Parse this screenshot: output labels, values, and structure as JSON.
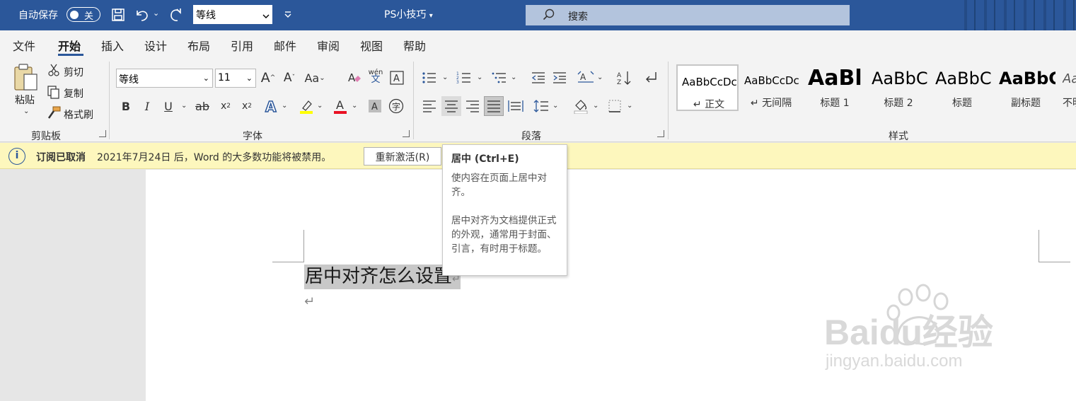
{
  "titlebar": {
    "autosave_label": "自动保存",
    "autosave_state": "关",
    "font_name": "等线",
    "doc_title": "PS小技巧",
    "search_placeholder": "搜索"
  },
  "tabs": [
    {
      "label": "文件"
    },
    {
      "label": "开始"
    },
    {
      "label": "插入"
    },
    {
      "label": "设计"
    },
    {
      "label": "布局"
    },
    {
      "label": "引用"
    },
    {
      "label": "邮件"
    },
    {
      "label": "审阅"
    },
    {
      "label": "视图"
    },
    {
      "label": "帮助"
    }
  ],
  "ribbon": {
    "clipboard": {
      "paste": "粘贴",
      "cut": "剪切",
      "copy": "复制",
      "format_painter": "格式刷",
      "group_label": "剪贴板"
    },
    "font": {
      "font_name": "等线",
      "font_size": "11",
      "group_label": "字体",
      "phonetic": "wén",
      "phonetic_char": "文"
    },
    "paragraph": {
      "group_label": "段落"
    },
    "styles": {
      "group_label": "样式",
      "items": [
        {
          "sample": "AaBbCcDc",
          "name": "↵ 正文"
        },
        {
          "sample": "AaBbCcDc",
          "name": "↵ 无间隔"
        },
        {
          "sample": "AaBl",
          "name": "标题 1"
        },
        {
          "sample": "AaBbC",
          "name": "标题 2"
        },
        {
          "sample": "AaBbC",
          "name": "标题"
        },
        {
          "sample": "AaBbC",
          "name": "副标题"
        },
        {
          "sample": "Aa",
          "name": "不明"
        }
      ]
    }
  },
  "message_bar": {
    "title": "订阅已取消",
    "text": "2021年7月24日 后，Word 的大多数功能将被禁用。",
    "button": "重新激活(R)"
  },
  "document": {
    "text": "居中对齐怎么设置"
  },
  "tooltip": {
    "title": "居中 (Ctrl+E)",
    "line1": "使内容在页面上居中对齐。",
    "line2": "居中对齐为文档提供正式的外观，通常用于封面、引言，有时用于标题。"
  },
  "watermark": {
    "brand": "Baidu经验",
    "url": "jingyan.baidu.com"
  },
  "colors": {
    "title_bar": "#2b579a",
    "message_bar": "#fdf7bd",
    "highlight_yellow": "#ffff00",
    "font_red": "#e81123"
  }
}
